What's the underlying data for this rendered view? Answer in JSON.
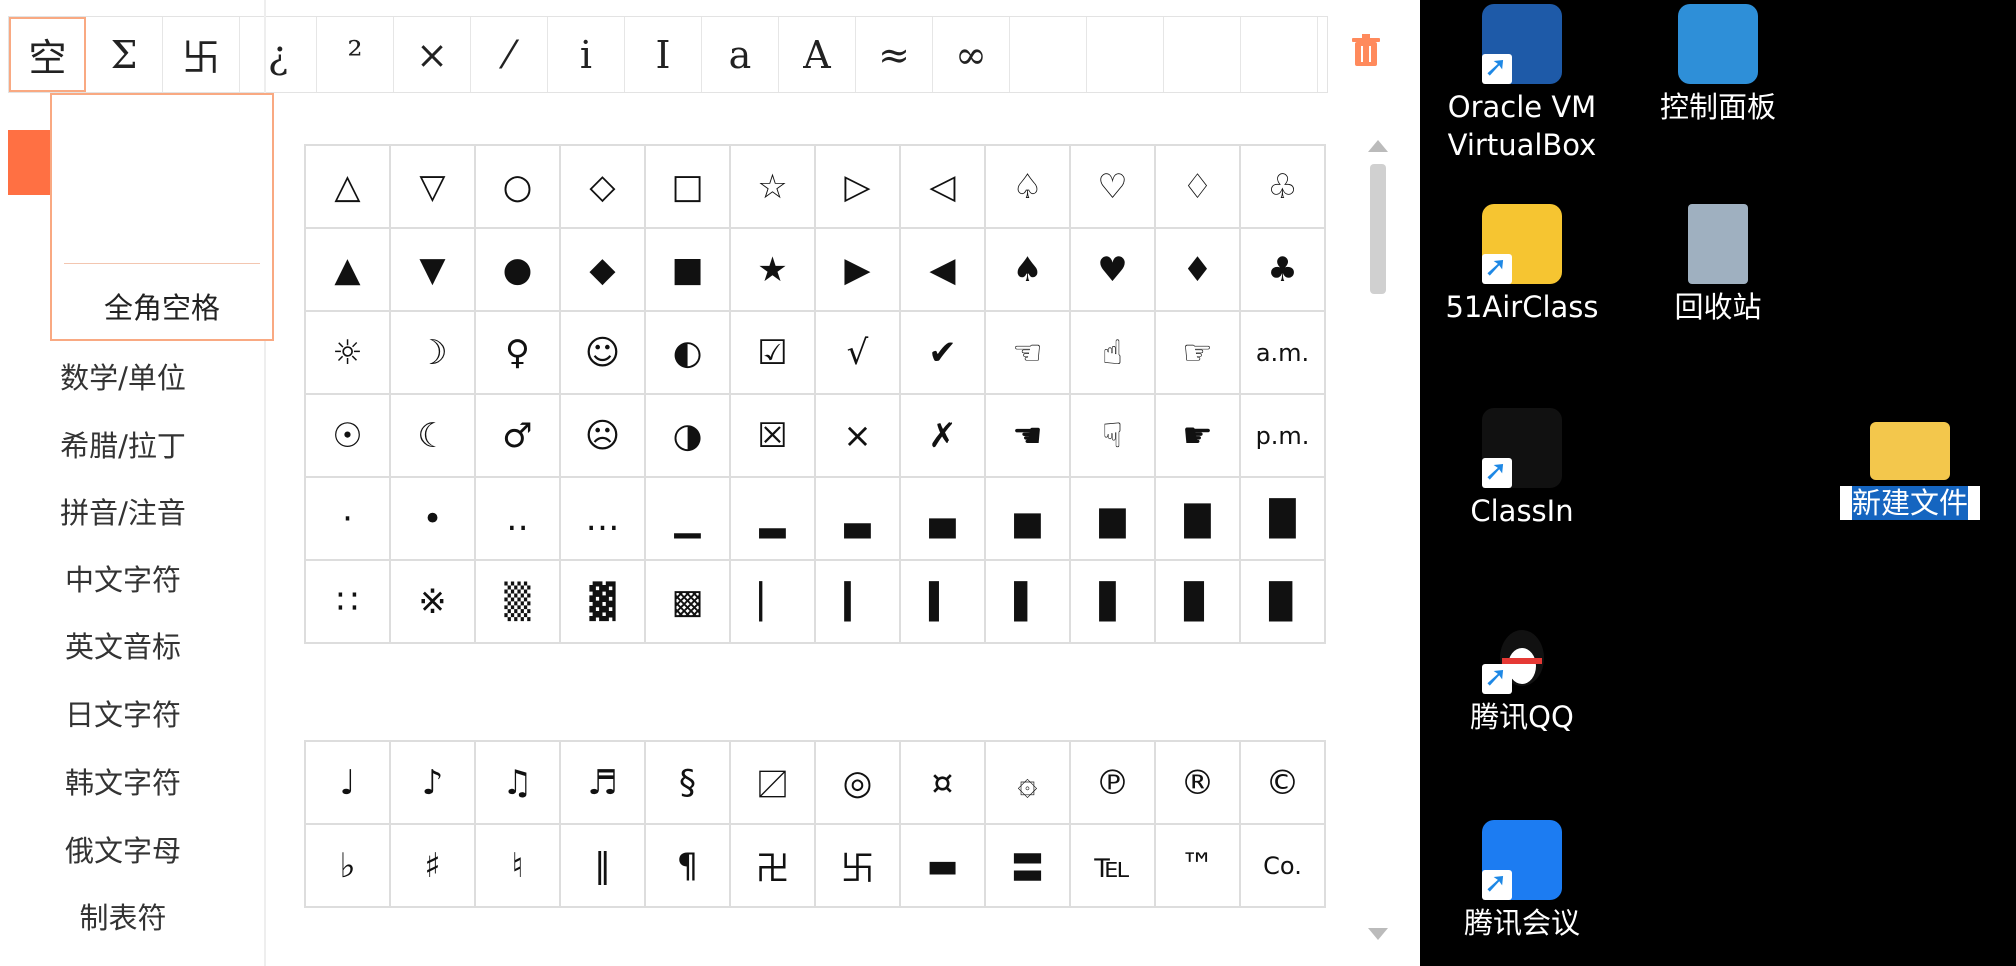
{
  "recent": [
    "空",
    "Σ",
    "卐",
    "¿",
    "²",
    "×",
    "⁄",
    "i",
    "I",
    "a",
    "A",
    "≈",
    "∞",
    "",
    "",
    "",
    ""
  ],
  "tooltip_label": "全角空格",
  "sidebar": [
    "数学/单位",
    "希腊/拉丁",
    "拼音/注音",
    "中文字符",
    "英文音标",
    "日文字符",
    "韩文字符",
    "俄文字母",
    "制表符"
  ],
  "grid1": [
    [
      "△",
      "▽",
      "○",
      "◇",
      "□",
      "☆",
      "▷",
      "◁",
      "♤",
      "♡",
      "♢",
      "♧"
    ],
    [
      "▲",
      "▼",
      "●",
      "◆",
      "■",
      "★",
      "▶",
      "◀",
      "♠",
      "♥",
      "♦",
      "♣"
    ],
    [
      "☼",
      "☽",
      "♀",
      "☺",
      "◐",
      "☑",
      "√",
      "✔",
      "☜",
      "☝",
      "☞",
      "a.m."
    ],
    [
      "☉",
      "☾",
      "♂",
      "☹",
      "◑",
      "☒",
      "×",
      "✗",
      "☚",
      "☟",
      "☛",
      "p.m."
    ],
    [
      "·",
      "•",
      "‥",
      "…",
      "▁",
      "▂",
      "▃",
      "▄",
      "▅",
      "▆",
      "▇",
      "█"
    ],
    [
      "∷",
      "※",
      "▒",
      "▓",
      "▩",
      "▏",
      "▎",
      "▍",
      "▌",
      "▋",
      "▊",
      "▉"
    ]
  ],
  "grid2": [
    [
      "♩",
      "♪",
      "♫",
      "♬",
      "§",
      "〼",
      "◎",
      "¤",
      "۞",
      "℗",
      "®",
      "©"
    ],
    [
      "♭",
      "♯",
      "♮",
      "‖",
      "¶",
      "卍",
      "卐",
      "▬",
      "〓",
      "℡",
      "™",
      "Co."
    ]
  ],
  "desktop": [
    {
      "name": "oracle-vm-virtualbox",
      "line1": "Oracle VM",
      "line2": "VirtualBox",
      "color": "#1e5aa8"
    },
    {
      "name": "control-panel",
      "line1": "控制面板",
      "line2": "",
      "color": "#2e8fd8"
    },
    {
      "name": "51airclass",
      "line1": "51AirClass",
      "line2": "",
      "color": "#f6c531"
    },
    {
      "name": "recycle-bin",
      "line1": "回收站",
      "line2": "",
      "color": "#9fb0c0"
    },
    {
      "name": "classin",
      "line1": "ClassIn",
      "line2": "",
      "color": "#111111"
    },
    {
      "name": "new-folder",
      "line1": "新建文件",
      "line2": "",
      "color": "#f3c74c"
    },
    {
      "name": "tencent-qq",
      "line1": "腾讯QQ",
      "line2": "",
      "color": "#000000"
    },
    {
      "name": "tencent-meeting",
      "line1": "腾讯会议",
      "line2": "",
      "color": "#1c7cf2"
    }
  ]
}
